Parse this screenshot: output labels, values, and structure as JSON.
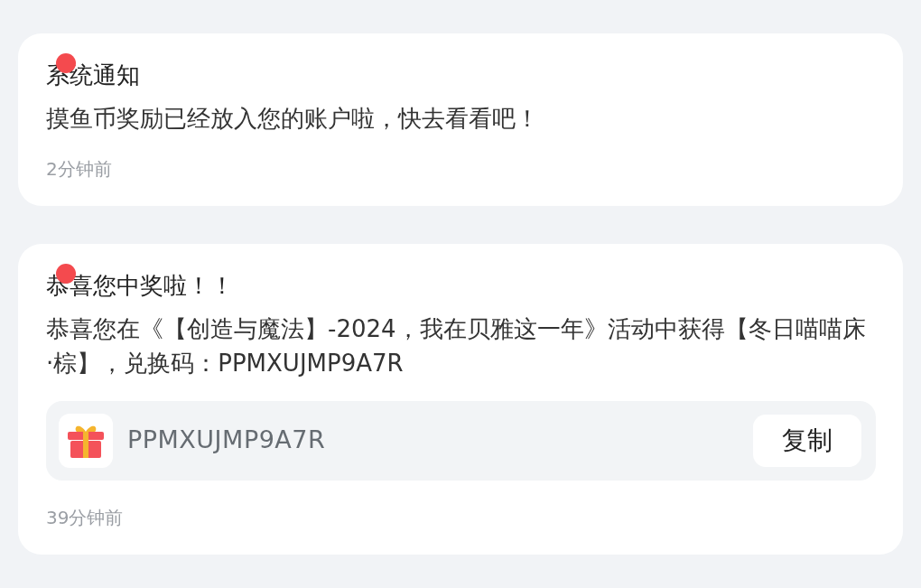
{
  "notifications": [
    {
      "title": "系统通知",
      "unread": true,
      "message": "摸鱼币奖励已经放入您的账户啦，快去看看吧！",
      "time": "2分钟前"
    },
    {
      "title": "恭喜您中奖啦！！",
      "unread": true,
      "message": "恭喜您在《【创造与魔法】-2024，我在贝雅这一年》活动中获得【冬日喵喵床·棕】，兑换码：PPMXUJMP9A7R",
      "code": {
        "value": "PPMXUJMP9A7R",
        "button": "复制"
      },
      "time": "39分钟前"
    }
  ]
}
